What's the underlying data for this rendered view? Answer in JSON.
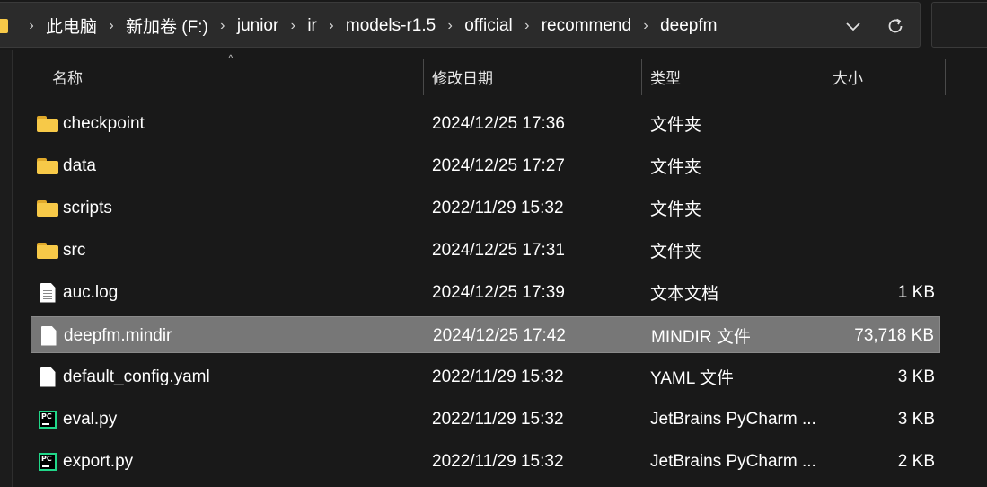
{
  "breadcrumb": [
    "此电脑",
    "新加卷 (F:)",
    "junior",
    "ir",
    "models-r1.5",
    "official",
    "recommend",
    "deepfm"
  ],
  "columns": {
    "name": "名称",
    "date": "修改日期",
    "type": "类型",
    "size": "大小"
  },
  "files": [
    {
      "icon": "folder-icon",
      "name": "checkpoint",
      "date": "2024/12/25 17:36",
      "type": "文件夹",
      "size": ""
    },
    {
      "icon": "folder-icon",
      "name": "data",
      "date": "2024/12/25 17:27",
      "type": "文件夹",
      "size": ""
    },
    {
      "icon": "folder-icon",
      "name": "scripts",
      "date": "2022/11/29 15:32",
      "type": "文件夹",
      "size": ""
    },
    {
      "icon": "folder-icon",
      "name": "src",
      "date": "2024/12/25 17:31",
      "type": "文件夹",
      "size": ""
    },
    {
      "icon": "text-file-icon",
      "name": "auc.log",
      "date": "2024/12/25 17:39",
      "type": "文本文档",
      "size": "1 KB"
    },
    {
      "icon": "file-icon",
      "name": "deepfm.mindir",
      "date": "2024/12/25 17:42",
      "type": "MINDIR 文件",
      "size": "73,718 KB",
      "selected": true
    },
    {
      "icon": "file-icon",
      "name": "default_config.yaml",
      "date": "2022/11/29 15:32",
      "type": "YAML 文件",
      "size": "3 KB"
    },
    {
      "icon": "pycharm-file-icon",
      "name": "eval.py",
      "date": "2022/11/29 15:32",
      "type": "JetBrains PyCharm ...",
      "size": "3 KB"
    },
    {
      "icon": "pycharm-file-icon",
      "name": "export.py",
      "date": "2022/11/29 15:32",
      "type": "JetBrains PyCharm ...",
      "size": "2 KB"
    }
  ],
  "colors": {
    "background": "#191919",
    "selected_row": "#777777",
    "folder": "#f7c948",
    "pycharm_accent": "#21d789"
  }
}
